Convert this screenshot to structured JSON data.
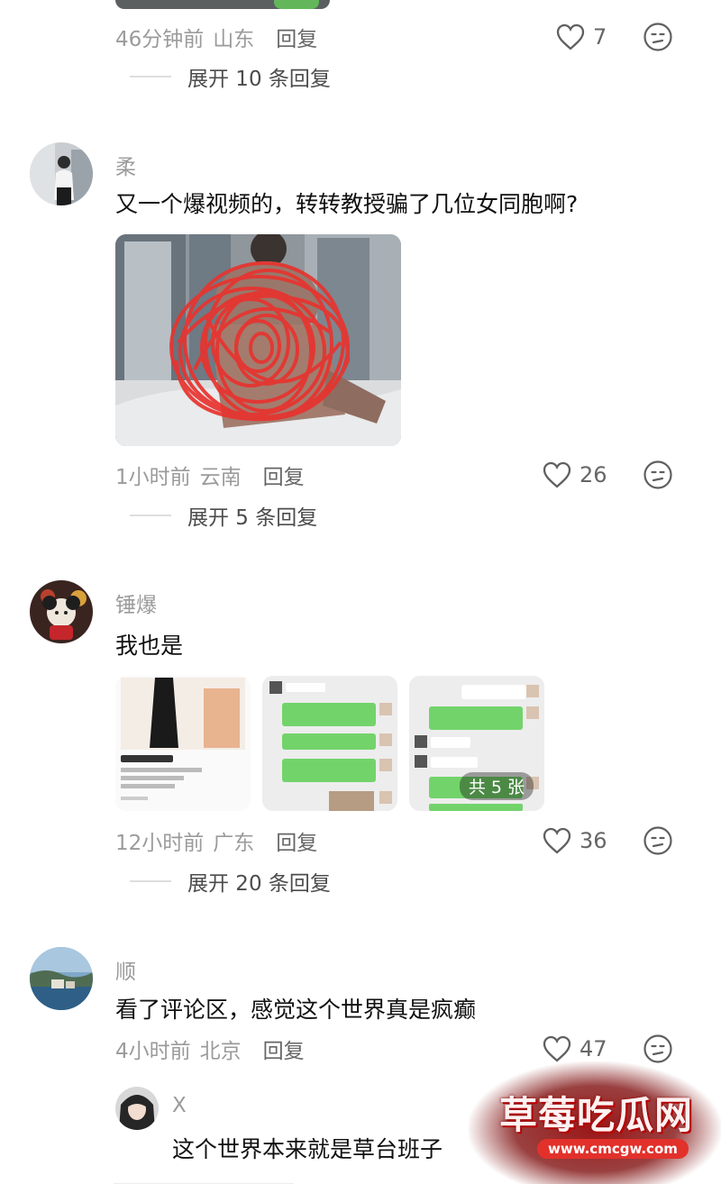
{
  "comments": [
    {
      "time": "46分钟前",
      "region": "山东",
      "reply_label": "回复",
      "likes": "7",
      "expand": "展开 10 条回复"
    },
    {
      "username": "柔",
      "text": "又一个爆视频的，转转教授骗了几位女同胞啊?",
      "time": "1小时前",
      "region": "云南",
      "reply_label": "回复",
      "likes": "26",
      "expand": "展开 5 条回复"
    },
    {
      "username": "锤爆",
      "text": "我也是",
      "time": "12小时前",
      "region": "广东",
      "reply_label": "回复",
      "likes": "36",
      "expand": "展开 20 条回复",
      "image_count": "共 5 张"
    },
    {
      "username": "顺",
      "text": "看了评论区，感觉这个世界真是疯癫",
      "time": "4小时前",
      "region": "北京",
      "reply_label": "回复",
      "likes": "47"
    }
  ],
  "reply": {
    "username": "X",
    "text": "这个世界本来就是草台班子"
  },
  "watermark": {
    "title": "草莓吃瓜网",
    "url": "www.cmcgw.com"
  },
  "colors": {
    "meta_gray": "#9b9b9b",
    "reply_gray": "#666666",
    "scribble_red": "#e8332f",
    "chat_green": "#73d36b"
  },
  "icons": {
    "like": "heart-outline-icon",
    "dislike": "frown-face-icon"
  }
}
